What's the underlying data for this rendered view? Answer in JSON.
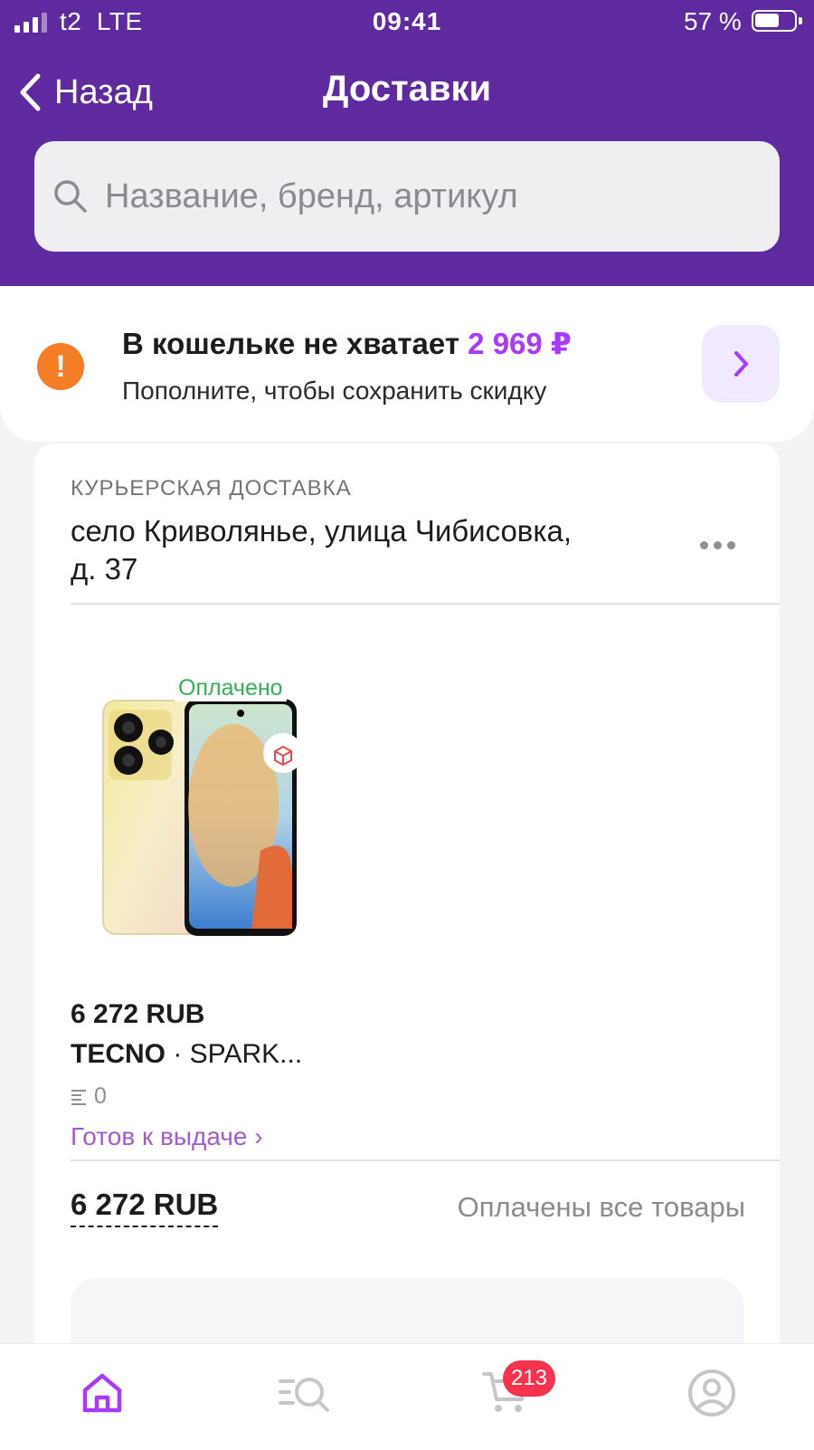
{
  "status_bar": {
    "carrier": "t2",
    "network": "LTE",
    "time": "09:41",
    "battery": "57 %"
  },
  "nav": {
    "back_label": "Назад",
    "title": "Доставки"
  },
  "search": {
    "placeholder": "Название, бренд, артикул"
  },
  "wallet": {
    "title_prefix": "В кошельке не хватает",
    "amount": "2 969 ₽",
    "subtitle": "Пополните, чтобы сохранить скидку",
    "warn_icon": "!"
  },
  "delivery": {
    "kind": "КУРЬЕРСКАЯ ДОСТАВКА",
    "address": "село Криволянье, улица Чибисовка, д. 37",
    "item": {
      "badge": "Оплачено",
      "price": "6 272 RUB",
      "brand": "TECNO",
      "name": "· SPARK...",
      "quantity": "0",
      "status": "Готов к выдаче ›"
    },
    "total": "6 272 RUB",
    "total_status": "Оплачены все товары"
  },
  "tabbar": {
    "cart_badge": "213"
  },
  "colors": {
    "brand_purple": "#5f29a0",
    "accent_purple": "#a73afd",
    "warning_orange": "#f47d26",
    "paid_green": "#35b056",
    "badge_red": "#f5334f"
  }
}
